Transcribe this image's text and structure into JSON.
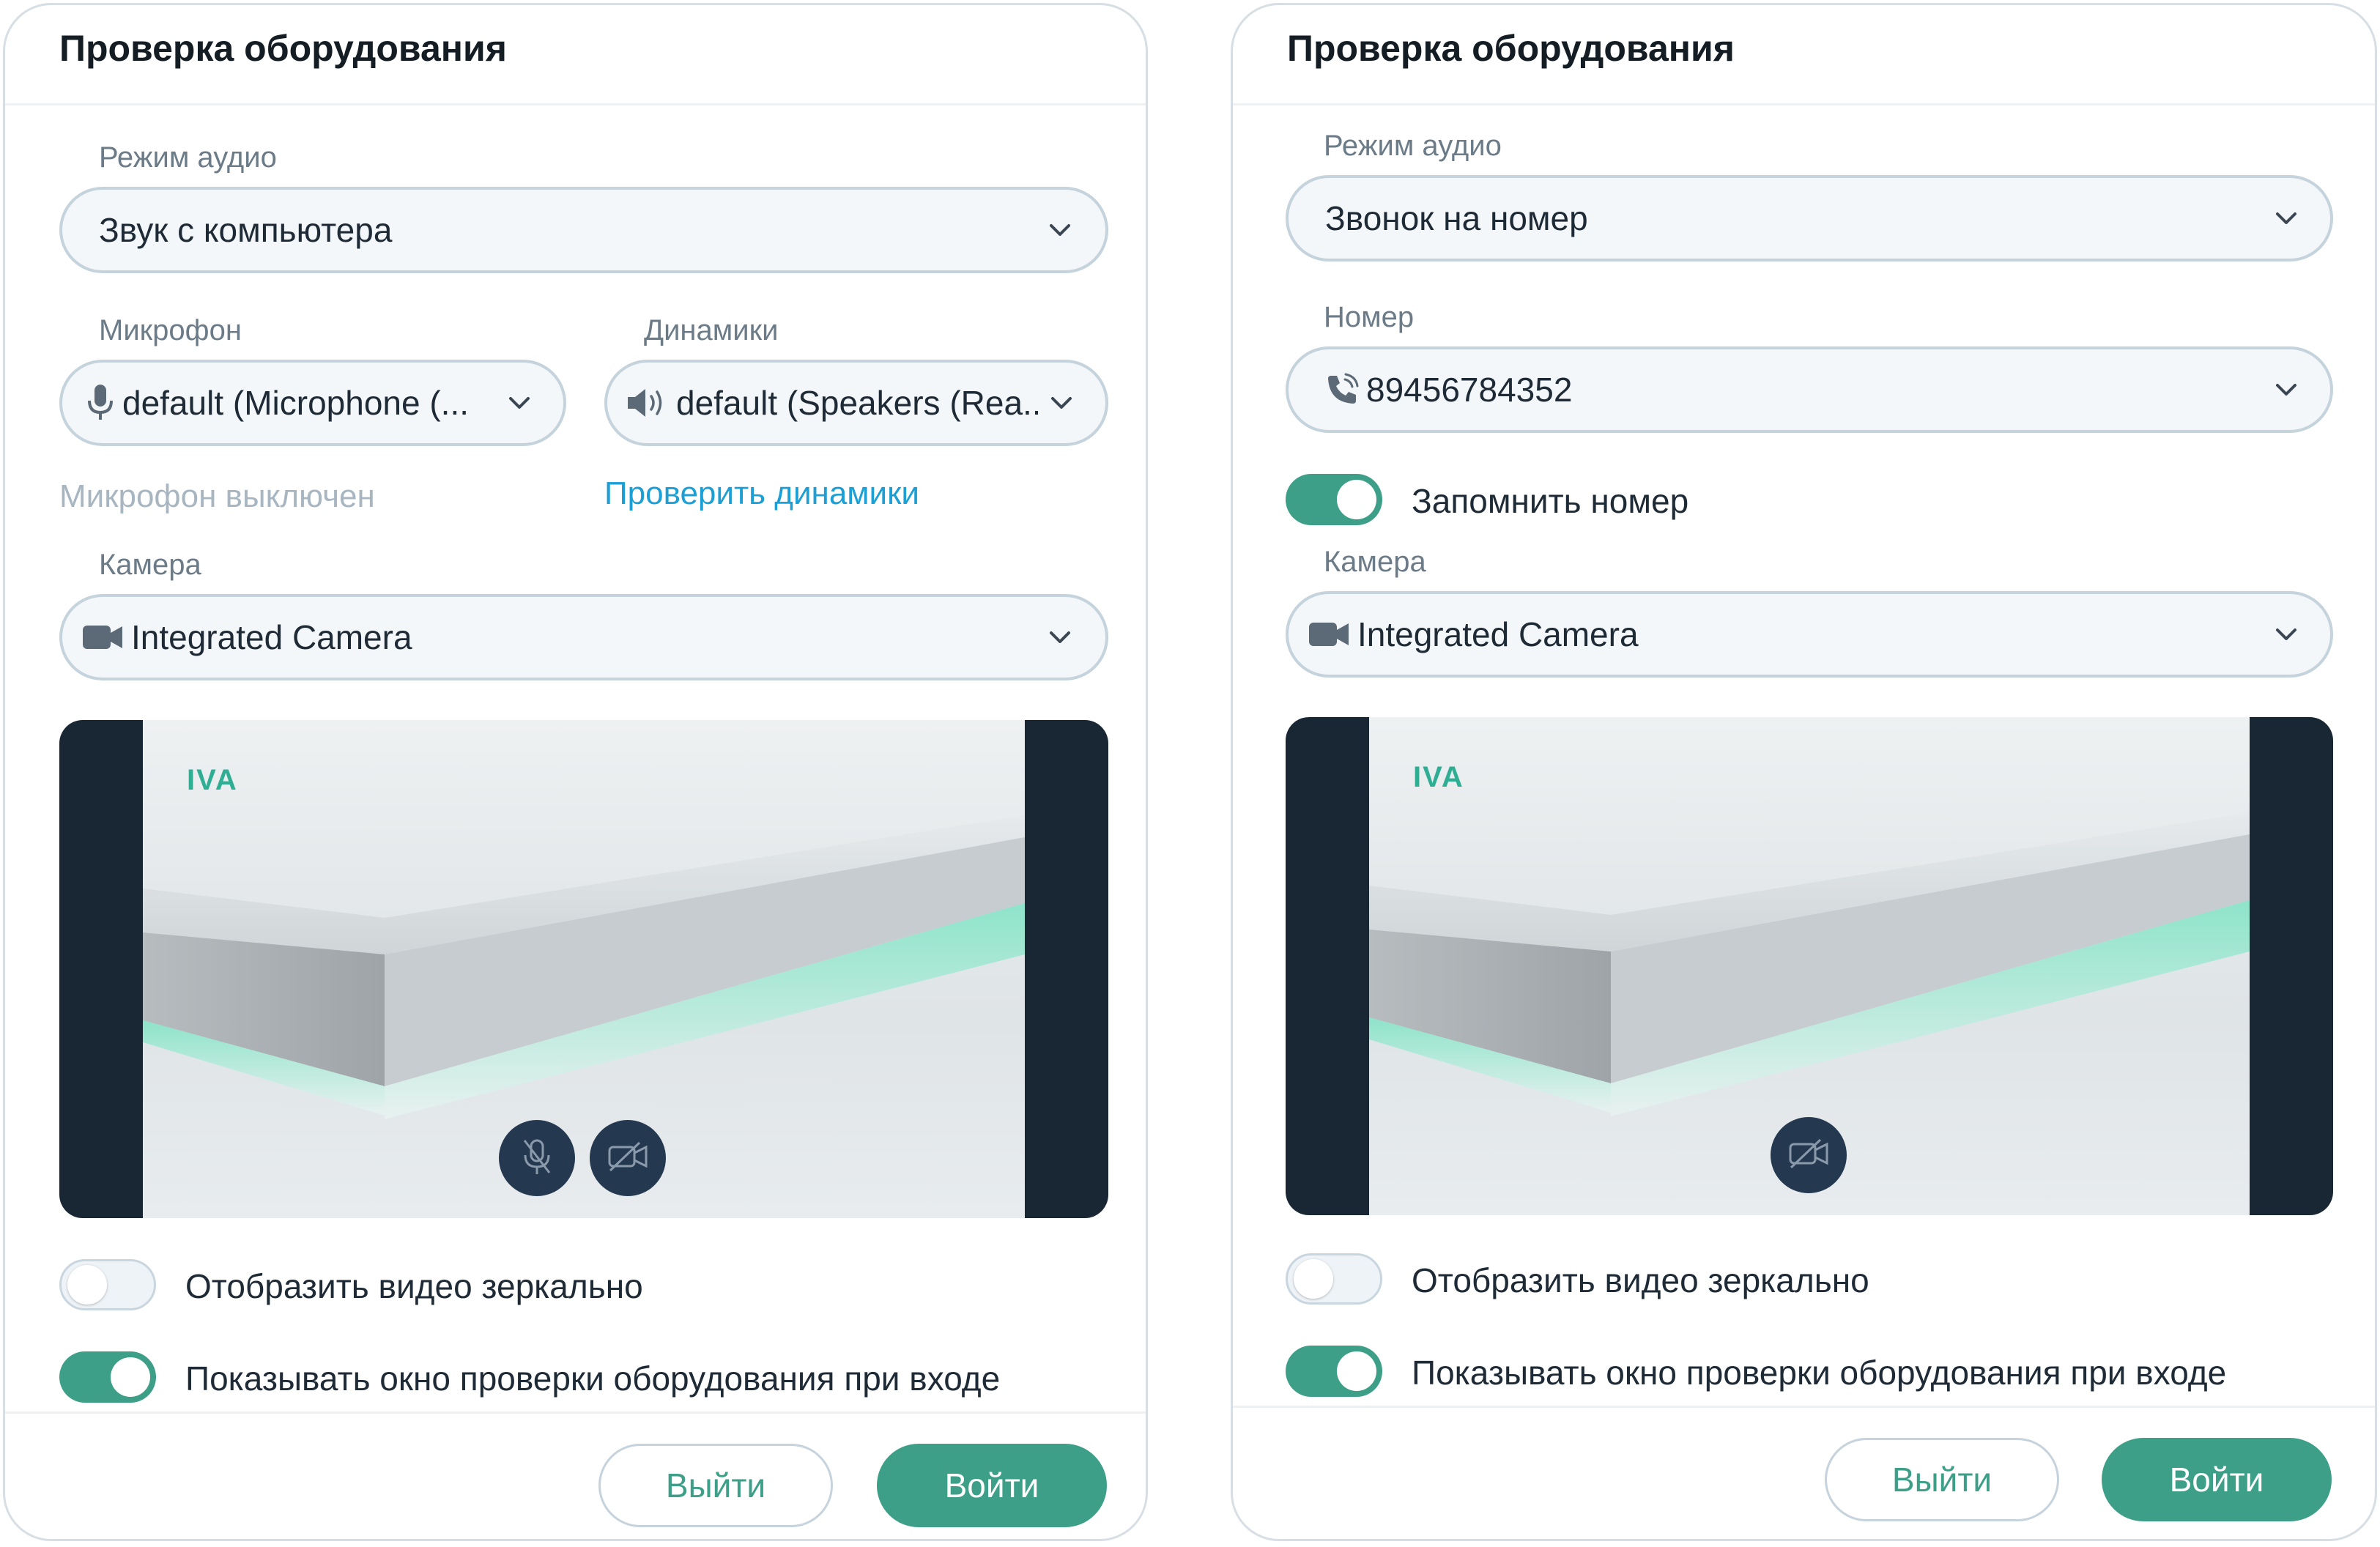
{
  "left": {
    "title": "Проверка оборудования",
    "audio_mode": {
      "label": "Режим аудио",
      "value": "Звук с компьютера"
    },
    "microphone": {
      "label": "Микрофон",
      "value": "default (Microphone (...",
      "status": "Микрофон выключен"
    },
    "speakers": {
      "label": "Динамики",
      "value": "default (Speakers (Rea...",
      "test_link": "Проверить динамики"
    },
    "camera": {
      "label": "Камера",
      "value": "Integrated Camera"
    },
    "preview": {
      "logo": "IVA"
    },
    "mirror_toggle": {
      "label": "Отобразить видео зеркально",
      "on": false
    },
    "show_check_toggle": {
      "label": "Показывать окно проверки оборудования при входе",
      "on": true
    },
    "buttons": {
      "exit": "Выйти",
      "enter": "Войти"
    }
  },
  "right": {
    "title": "Проверка оборудования",
    "audio_mode": {
      "label": "Режим аудио",
      "value": "Звонок на номер"
    },
    "number": {
      "label": "Номер",
      "value": "89456784352"
    },
    "remember_toggle": {
      "label": "Запомнить номер",
      "on": true
    },
    "camera": {
      "label": "Камера",
      "value": "Integrated Camera"
    },
    "preview": {
      "logo": "IVA"
    },
    "mirror_toggle": {
      "label": "Отобразить видео зеркально",
      "on": false
    },
    "show_check_toggle": {
      "label": "Показывать окно проверки оборудования при входе",
      "on": true
    },
    "buttons": {
      "exit": "Выйти",
      "enter": "Войти"
    }
  },
  "colors": {
    "accent": "#3d9f88",
    "link": "#1b9fd5",
    "muted": "#a8b6c1",
    "preview_bg": "#192735",
    "control_bg": "#24384f"
  },
  "icons": {
    "chevron": "chevron-down-icon",
    "microphone": "microphone-icon",
    "speaker": "speaker-icon",
    "camera": "video-camera-icon",
    "phone": "phone-icon",
    "mic_off": "microphone-off-icon",
    "camera_off": "camera-off-icon"
  }
}
